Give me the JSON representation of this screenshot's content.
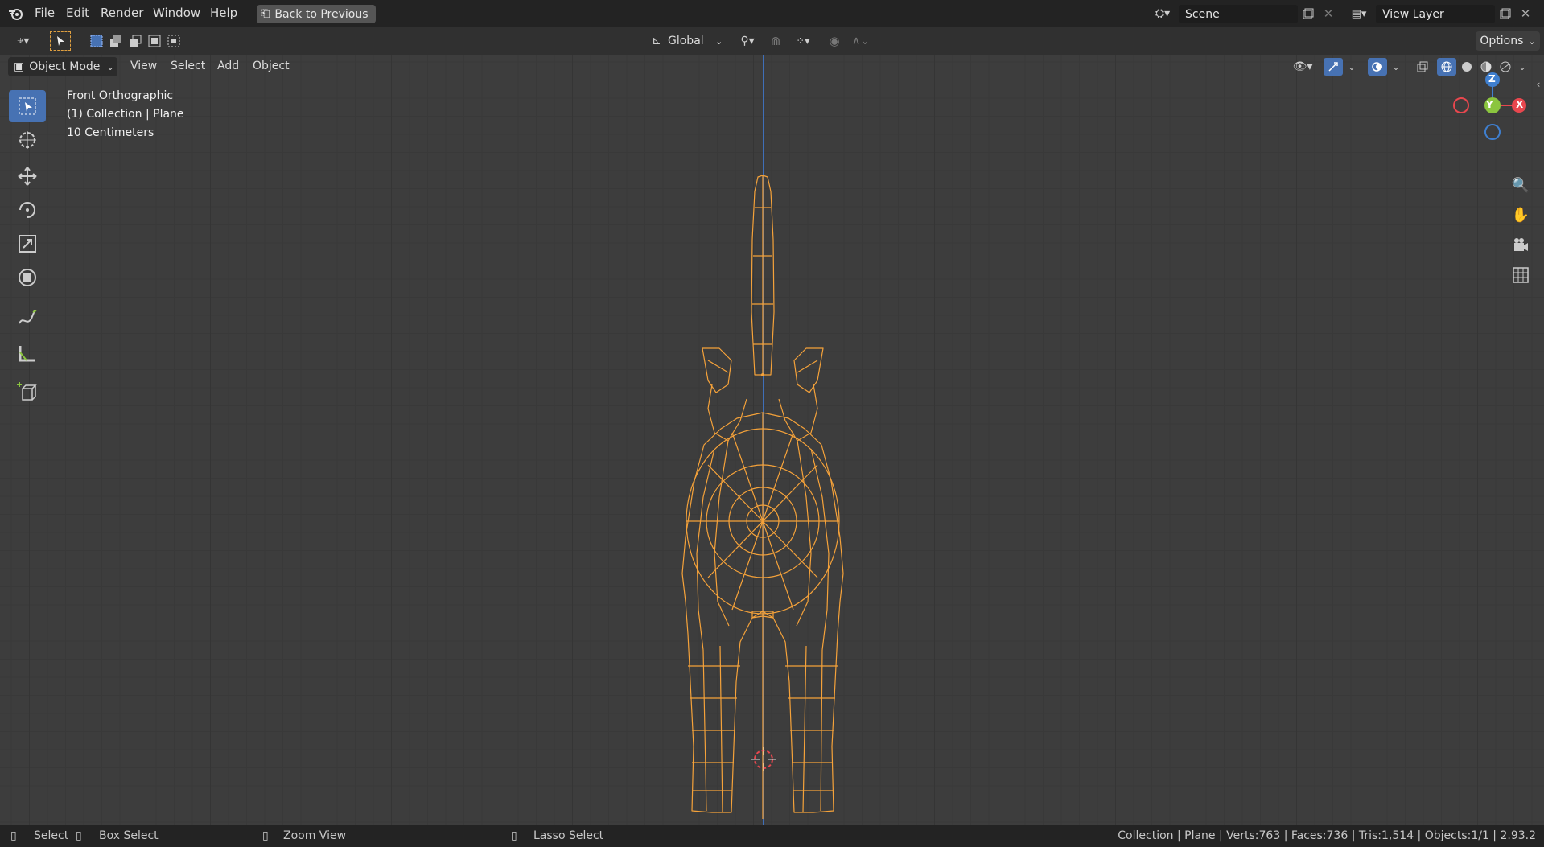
{
  "topbar": {
    "menu": [
      "File",
      "Edit",
      "Render",
      "Window",
      "Help"
    ],
    "back_button": "Back to Previous",
    "scene_name": "Scene",
    "view_layer_name": "View Layer"
  },
  "tool_header": {
    "orientation": "Global",
    "options_label": "Options"
  },
  "view_header": {
    "mode": "Object Mode",
    "menu": [
      "View",
      "Select",
      "Add",
      "Object"
    ]
  },
  "viewport": {
    "view_name": "Front Orthographic",
    "collection_info": "(1) Collection | Plane",
    "scale_info": "10 Centimeters",
    "gizmo": {
      "z": "Z",
      "y": "Y",
      "x": "X"
    }
  },
  "toolbar_tools": [
    "select-box-tool",
    "cursor-tool",
    "move-tool",
    "rotate-tool",
    "scale-tool",
    "transform-tool",
    "annotate-tool",
    "measure-tool",
    "add-cube-tool"
  ],
  "statusbar": {
    "select": "Select",
    "box_select": "Box Select",
    "zoom_view": "Zoom View",
    "lasso_select": "Lasso Select",
    "stats": "Collection | Plane | Verts:763 | Faces:736 | Tris:1,514 | Objects:1/1 | 2.93.2"
  },
  "colors": {
    "wire_selected": "#f5a23a",
    "axis_x": "#e8474e",
    "axis_y": "#8bc53f",
    "axis_z": "#3f7fcf",
    "active_tool": "#4772b3"
  }
}
